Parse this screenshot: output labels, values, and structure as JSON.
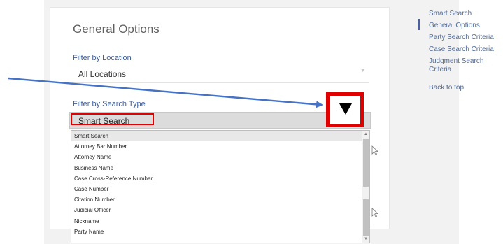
{
  "main": {
    "heading": "General Options",
    "location_label": "Filter by Location",
    "location_value": "All Locations",
    "search_type_label": "Filter by Search Type",
    "search_type_value": "Smart Search"
  },
  "dropdown": {
    "options": [
      "Smart Search",
      "Attorney Bar Number",
      "Attorney Name",
      "Business Name",
      "Case Cross-Reference Number",
      "Case Number",
      "Citation Number",
      "Judicial Officer",
      "Nickname",
      "Party Name"
    ],
    "selected_index": 0
  },
  "toc": {
    "items": [
      "Smart Search",
      "General Options",
      "Party Search Criteria",
      "Case Search Criteria",
      "Judgment Search Criteria"
    ],
    "active_index": 1,
    "back_to_top": "Back to top"
  },
  "annotation": {
    "highlight_color": "#e00000",
    "arrow_color": "#4472c4"
  }
}
